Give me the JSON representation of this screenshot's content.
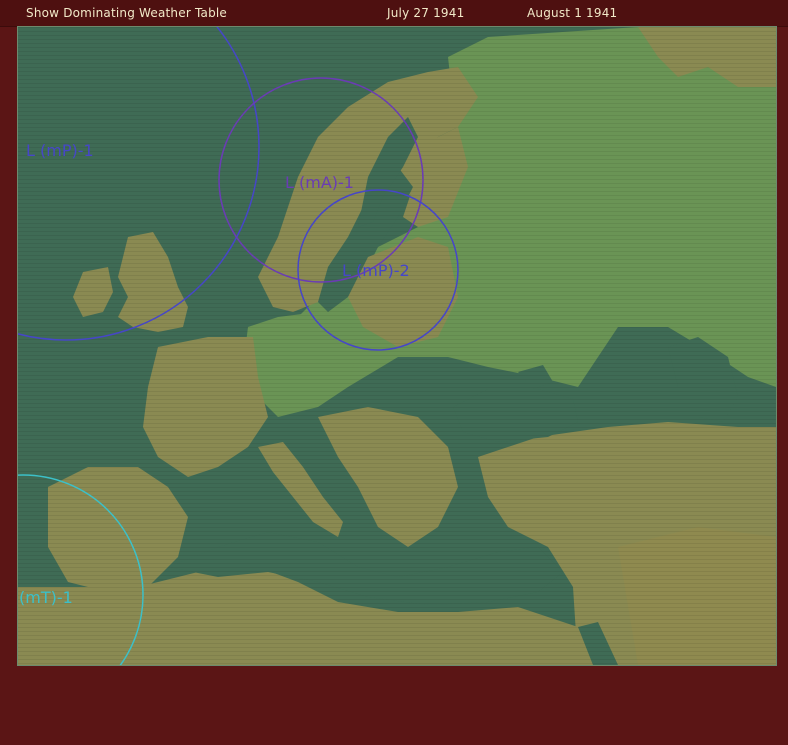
{
  "topbar": {
    "weather_table_link": "Show Dominating Weather Table",
    "date_start": "July 27 1941",
    "date_end": "August 1 1941"
  },
  "colors": {
    "frame": "#5b1515",
    "sea": "#3f6b55",
    "land_green": "#6a9455",
    "land_brown": "#8a8a52",
    "front_blue": "#4646c8",
    "front_purple": "#6a3cb4",
    "front_cyan": "#3cc0c8"
  },
  "weather_systems": [
    {
      "label": "L (mP)-1",
      "color": "#4646c8"
    },
    {
      "label": "L (mA)-1",
      "color": "#6a3cb4"
    },
    {
      "label": "L (mP)-2",
      "color": "#4646c8"
    },
    {
      "label": "(mT)-1",
      "color": "#3cc0c8"
    }
  ]
}
